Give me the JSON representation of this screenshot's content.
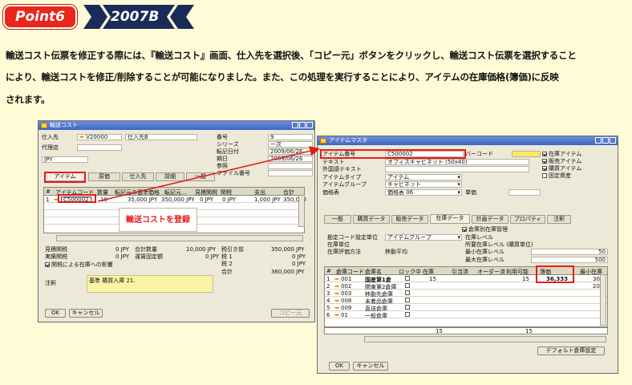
{
  "header": {
    "point_label": "Point6",
    "version_label": "2007B"
  },
  "description": {
    "line1": "輸送コスト伝票を修正する際には、『輸送コスト』画面、仕入先を選択後、「コピー元」ボタンをクリックし、輸送コスト伝票を選択すること",
    "line2": "により、輸送コストを修正/削除することが可能になりました。また、この処理を実行することにより、アイテムの在庫価格(簿価)に反映",
    "line3": "されます。"
  },
  "left_window": {
    "title": "輸送コスト",
    "fields": {
      "vendor_label": "仕入先",
      "vendor_code": "V20000",
      "vendor_name": "仕入先B",
      "agent_label": "代理店",
      "currency": "JPY",
      "number_label": "番号",
      "number_value": "9",
      "series_label": "シリーズ",
      "series_value": "一次",
      "posting_date_label": "転記日付",
      "posting_date_value": "2009/06/26",
      "due_date_label": "期日",
      "due_date_value": "2009/06/26",
      "ref_label": "参照",
      "vendor_ref_label": "ファイル番号"
    },
    "tabs": [
      "アイテム",
      "原価",
      "仕入先",
      "詳細",
      "一般"
    ],
    "grid_headers": [
      "#",
      "アイテムコード",
      "数量",
      "転記元の基準価格",
      "転記元...",
      "見積関税",
      "関税",
      "支出",
      "合計"
    ],
    "grid_row": {
      "num": "1",
      "code": "C500002",
      "qty": "10",
      "base_price": "35,000 JPY",
      "src": "350,000 JPY",
      "est_duty": "0 JPY",
      "duty": "0 JPY",
      "expense": "1,000 JPY",
      "total": "350,000"
    },
    "annotation": "輸送コストを登録",
    "totals": {
      "est_customs_label": "見積関税",
      "est_customs_value": "0 JPY",
      "actual_customs_label": "実績関税",
      "actual_customs_value": "0 JPY",
      "total_cost_label": "合計数量",
      "total_cost_value": "10,000 JPY",
      "fixed_label": "運賃固定額",
      "fixed_value": "0 JPY",
      "pretax_label": "税引き前",
      "pretax_value": "350,000 JPY",
      "tax1_label": "税 1",
      "tax1_value": "0 JPY",
      "tax2_label": "税 2",
      "tax2_value": "0 JPY",
      "grand_label": "合計",
      "grand_value": "360,000 JPY",
      "impact_label": "関税による在庫への影響"
    },
    "remarks_label": "注釈",
    "remarks_value": "基準 購買入庫 21.",
    "ok_button": "OK",
    "cancel_button": "キャンセル",
    "copy_from_button": "コピー元"
  },
  "right_window": {
    "title": "アイテムマスタ",
    "fields": {
      "item_no_label": "アイテム番号",
      "item_no_value": "C500002",
      "text_label": "テキスト",
      "text_value": "オフィスキャビネット (50x40)",
      "foreign_label": "外国語テキスト",
      "type_label": "アイテムタイプ",
      "type_value": "アイテム",
      "group_label": "アイテムグループ",
      "group_value": "キャビネット",
      "price_list_label": "価格表",
      "price_list_value": "価格表 06",
      "unit_price_label": "単価",
      "barcode_label": "バーコード",
      "inventory_item": "在庫アイテム",
      "sales_item": "販売アイテム",
      "purchase_item": "購買アイテム",
      "fixed_asset": "固定資産"
    },
    "tabs": [
      "一般",
      "購買データ",
      "販売データ",
      "在庫データ",
      "計画データ",
      "プロパティ",
      "注釈"
    ],
    "inv_fields": {
      "gl_method_label": "勘定コード設定単位",
      "gl_method_value": "アイテムグループ",
      "uom_label": "在庫単位",
      "valuation_label": "在庫評価方法",
      "valuation_value": "移動平均",
      "manage_by_wh": "倉庫別在庫管理",
      "inv_level_label": "在庫レベル",
      "req_label": "所要在庫レベル (購買単位)",
      "min_label": "最小在庫レベル",
      "min_value": "50",
      "max_label": "最大在庫レベル",
      "max_value": "500"
    },
    "grid_headers": [
      "#",
      "倉庫コード",
      "倉庫名",
      "ロック中",
      "在庫",
      "引当済",
      "オーダー済",
      "利用可能",
      "簿価",
      "最小在庫"
    ],
    "grid_rows": [
      {
        "num": "1",
        "code": "001",
        "name": "国産第1倉",
        "stock": "15",
        "avail": "15",
        "cost": "36,333",
        "min": "30"
      },
      {
        "num": "2",
        "code": "002",
        "name": "関東第2倉庫",
        "stock": "",
        "avail": "",
        "cost": "",
        "min": "20"
      },
      {
        "num": "3",
        "code": "003",
        "name": "移動先倉庫",
        "stock": "",
        "avail": "",
        "cost": "",
        "min": ""
      },
      {
        "num": "4",
        "code": "008",
        "name": "未着品倉庫",
        "stock": "",
        "avail": "",
        "cost": "",
        "min": ""
      },
      {
        "num": "5",
        "code": "009",
        "name": "直送倉庫",
        "stock": "",
        "avail": "",
        "cost": "",
        "min": ""
      },
      {
        "num": "6",
        "code": "01",
        "name": "一般倉庫",
        "stock": "",
        "avail": "",
        "cost": "",
        "min": ""
      }
    ],
    "footer_stock": "15",
    "footer_avail": "15",
    "default_wh_button": "デフォルト倉庫設定",
    "ok_button": "OK",
    "cancel_button": "キャンセル"
  },
  "colors": {
    "accent_red": "#e51c1c",
    "background": "#fffbd6",
    "navy": "#1a2a5a"
  }
}
